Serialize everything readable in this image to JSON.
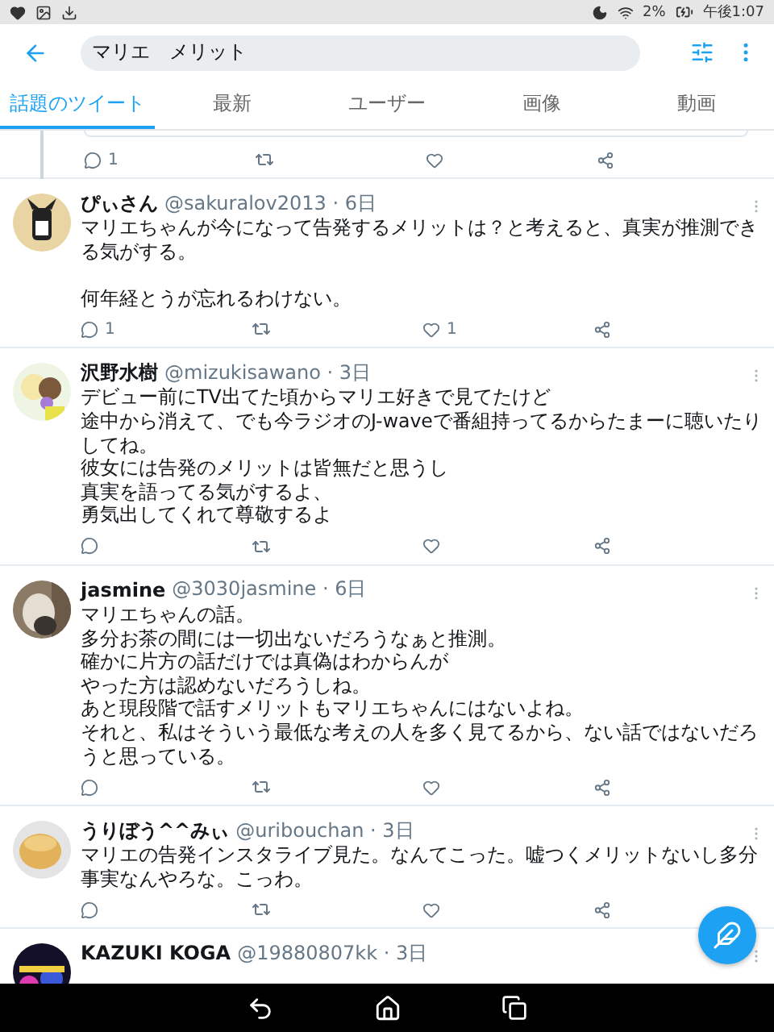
{
  "status_bar": {
    "battery": "2%",
    "time": "午後1:07"
  },
  "search": {
    "value": "マリエ　メリット"
  },
  "tabs": [
    {
      "label": "話題のツイート",
      "selected": true
    },
    {
      "label": "最新",
      "selected": false
    },
    {
      "label": "ユーザー",
      "selected": false
    },
    {
      "label": "画像",
      "selected": false
    },
    {
      "label": "動画",
      "selected": false
    }
  ],
  "previous_tweet_actions": {
    "replies": "1"
  },
  "tweets": [
    {
      "name": "ぴぃさん",
      "meta": "@sakuralov2013 · 6日",
      "paragraphs": [
        [
          "マリエちゃんが今になって告発するメリットは？と考えると、真実が推測でき",
          "る気がする。"
        ],
        [
          "何年経とうが忘れるわけない。"
        ]
      ],
      "replies": "1",
      "likes": "1"
    },
    {
      "name": "沢野水樹",
      "meta": "@mizukisawano · 3日",
      "paragraphs": [
        [
          "デビュー前にTV出てた頃からマリエ好きで見てたけど",
          "途中から消えて、でも今ラジオのJ-waveで番組持ってるからたまーに聴いたり",
          "してね。",
          "彼女には告発のメリットは皆無だと思うし",
          "真実を語ってる気がするよ、",
          "勇気出してくれて尊敬するよ"
        ]
      ]
    },
    {
      "name": "jasmine",
      "meta": "@3030jasmine · 6日",
      "paragraphs": [
        [
          "マリエちゃんの話。",
          "多分お茶の間には一切出ないだろうなぁと推測。",
          "確かに片方の話だけでは真偽はわからんが",
          "やった方は認めないだろうしね。",
          "あと現段階で話すメリットもマリエちゃんにはないよね。",
          "それと、私はそういう最低な考えの人を多く見てるから、ない話ではないだろ",
          "うと思っている。"
        ]
      ]
    },
    {
      "name": "うりぼう^^みぃ",
      "meta": "@uribouchan · 3日",
      "paragraphs": [
        [
          "マリエの告発インスタライブ見た。なんてこった。嘘つくメリットないし多分",
          "事実なんやろな。こっわ。"
        ]
      ]
    },
    {
      "name": "KAZUKI KOGA",
      "meta": "@19880807kk · 3日"
    }
  ]
}
